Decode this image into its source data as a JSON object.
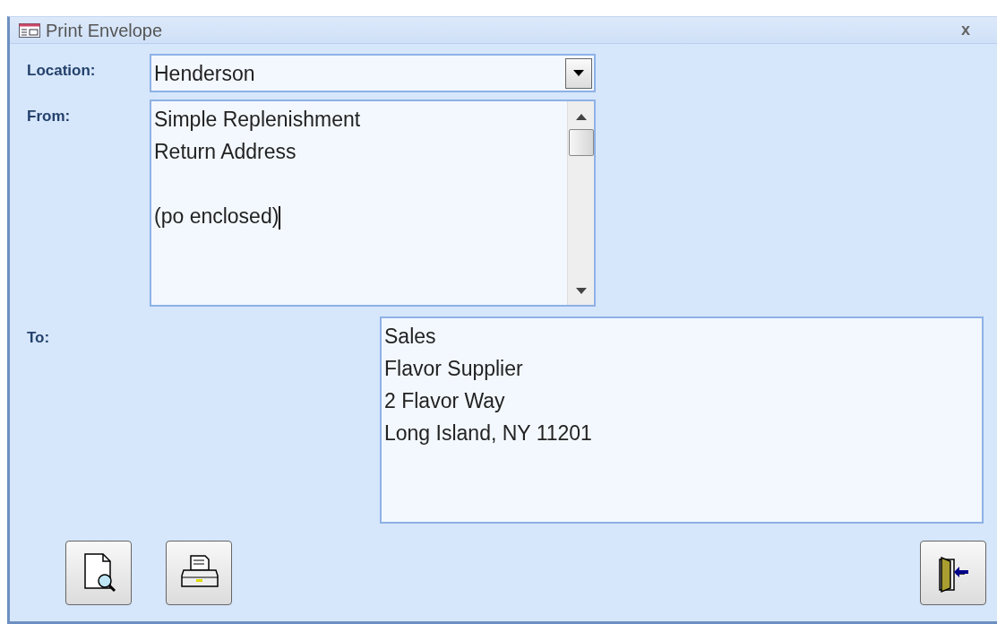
{
  "window": {
    "title": "Print Envelope",
    "close": "x"
  },
  "location": {
    "label": "Location:",
    "value": "Henderson"
  },
  "from": {
    "label": "From:",
    "value": "Simple Replenishment\nReturn Address\n\n(po enclosed)",
    "focused": true
  },
  "to": {
    "label": "To:",
    "value": "Sales\nFlavor Supplier\n2 Flavor Way\nLong Island, NY 11201"
  },
  "buttons": [
    {
      "kind": "preview"
    },
    {
      "kind": "print"
    },
    {
      "kind": "exit"
    }
  ]
}
